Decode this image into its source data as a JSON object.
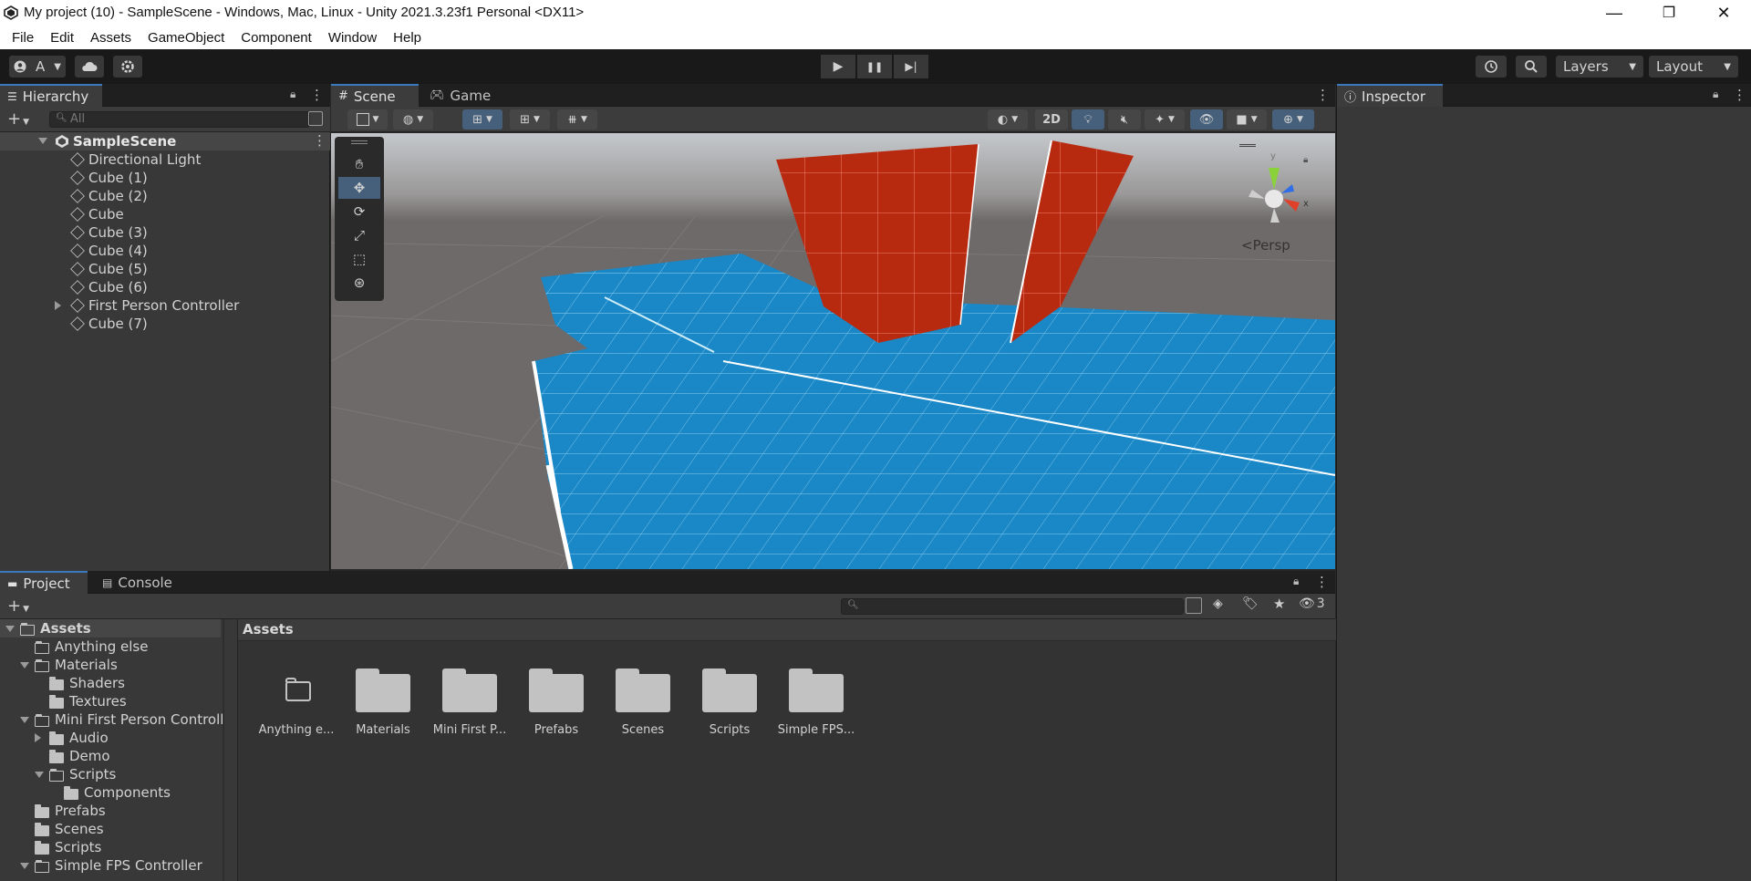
{
  "window": {
    "title": "My project (10) - SampleScene - Windows, Mac, Linux - Unity 2021.3.23f1 Personal <DX11>",
    "controls": {
      "minimize": "—",
      "restore": "❐",
      "close": "✕"
    }
  },
  "menu": [
    "File",
    "Edit",
    "Assets",
    "GameObject",
    "Component",
    "Window",
    "Help"
  ],
  "toolbar": {
    "account_label": "A",
    "layers_label": "Layers",
    "layout_label": "Layout",
    "play_icons": {
      "play": "▶",
      "pause": "❚❚",
      "step": "▶|"
    }
  },
  "hierarchy": {
    "tab_label": "Hierarchy",
    "search_placeholder": "All",
    "scene_name": "SampleScene",
    "items": [
      {
        "label": "Directional Light",
        "expandable": false
      },
      {
        "label": "Cube (1)",
        "expandable": false
      },
      {
        "label": "Cube (2)",
        "expandable": false
      },
      {
        "label": "Cube",
        "expandable": false
      },
      {
        "label": "Cube (3)",
        "expandable": false
      },
      {
        "label": "Cube (4)",
        "expandable": false
      },
      {
        "label": "Cube (5)",
        "expandable": false
      },
      {
        "label": "Cube (6)",
        "expandable": false
      },
      {
        "label": "First Person Controller",
        "expandable": true
      },
      {
        "label": "Cube (7)",
        "expandable": false
      }
    ]
  },
  "scene_view": {
    "tabs": [
      "Scene",
      "Game"
    ],
    "active_tab": "Scene",
    "toggle_2d_label": "2D",
    "persp_label": "<Persp",
    "gizmo_axes": {
      "y": "y",
      "x": "x"
    },
    "colors": {
      "floor": "#1a87c7",
      "wall": "#b82a10",
      "sky": "#c9cdd1",
      "ground": "#6b6767"
    }
  },
  "inspector": {
    "tab_label": "Inspector"
  },
  "project": {
    "tabs": [
      "Project",
      "Console"
    ],
    "active_tab": "Project",
    "hidden_count": "3",
    "tree": [
      {
        "label": "Assets",
        "indent": 0,
        "arrow": "down",
        "icon": "open",
        "bold": true,
        "selected": true
      },
      {
        "label": "Anything else",
        "indent": 1,
        "arrow": "none",
        "icon": "empty"
      },
      {
        "label": "Materials",
        "indent": 1,
        "arrow": "down",
        "icon": "open"
      },
      {
        "label": "Shaders",
        "indent": 2,
        "arrow": "none",
        "icon": "closed"
      },
      {
        "label": "Textures",
        "indent": 2,
        "arrow": "none",
        "icon": "closed"
      },
      {
        "label": "Mini First Person Controll",
        "indent": 1,
        "arrow": "down",
        "icon": "open"
      },
      {
        "label": "Audio",
        "indent": 2,
        "arrow": "right",
        "icon": "closed"
      },
      {
        "label": "Demo",
        "indent": 2,
        "arrow": "none",
        "icon": "closed"
      },
      {
        "label": "Scripts",
        "indent": 2,
        "arrow": "down",
        "icon": "open"
      },
      {
        "label": "Components",
        "indent": 3,
        "arrow": "none",
        "icon": "closed"
      },
      {
        "label": "Prefabs",
        "indent": 1,
        "arrow": "none",
        "icon": "closed"
      },
      {
        "label": "Scenes",
        "indent": 1,
        "arrow": "none",
        "icon": "closed"
      },
      {
        "label": "Scripts",
        "indent": 1,
        "arrow": "none",
        "icon": "closed"
      },
      {
        "label": "Simple FPS Controller",
        "indent": 1,
        "arrow": "down",
        "icon": "open"
      }
    ],
    "breadcrumb": "Assets",
    "assets": [
      {
        "label": "Anything e...",
        "empty": true
      },
      {
        "label": "Materials",
        "empty": false
      },
      {
        "label": "Mini First P...",
        "empty": false
      },
      {
        "label": "Prefabs",
        "empty": false
      },
      {
        "label": "Scenes",
        "empty": false
      },
      {
        "label": "Scripts",
        "empty": false
      },
      {
        "label": "Simple FPS...",
        "empty": false
      }
    ]
  }
}
